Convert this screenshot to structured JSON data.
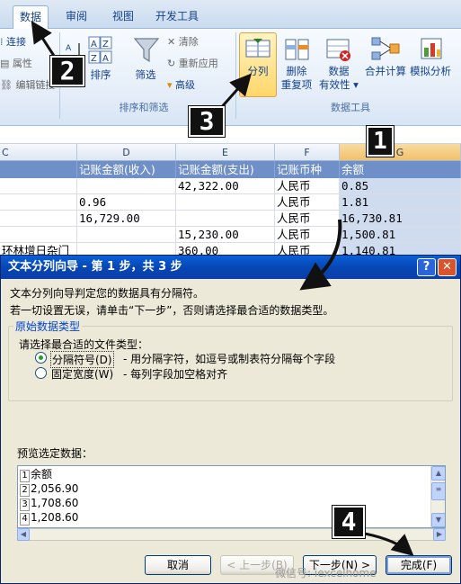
{
  "ribbon": {
    "tabs": [
      "数据",
      "审阅",
      "视图",
      "开发工具"
    ],
    "connections": {
      "items": [
        "连接",
        "属性",
        "编辑链接"
      ]
    },
    "sort": {
      "label": "排序"
    },
    "filter": {
      "label": "筛选",
      "items": [
        "清除",
        "重新应用",
        "高级"
      ]
    },
    "group_sort_filter": "排序和筛选",
    "split": {
      "label": "分列"
    },
    "dedupe": {
      "label_1": "删除",
      "label_2": "重复项"
    },
    "validate": {
      "label_1": "数据",
      "label_2": "有效性"
    },
    "consolidate": {
      "label": "合并计算"
    },
    "whatif": {
      "label": "模拟分析"
    },
    "group_data_tools": "数据工具"
  },
  "sheet": {
    "columns": [
      "C",
      "D",
      "E",
      "F",
      "G"
    ],
    "headers": [
      "记账金额(收入)",
      "记账金额(支出)",
      "记账币种",
      "余额"
    ],
    "rows": [
      {
        "c": "",
        "d": "",
        "e": "42,322.00",
        "f": "人民币",
        "g": "0.85"
      },
      {
        "c": "",
        "d": "0.96",
        "e": "",
        "f": "人民币",
        "g": "1.81"
      },
      {
        "c": "",
        "d": "16,729.00",
        "e": "",
        "f": "人民币",
        "g": "16,730.81"
      },
      {
        "c": "",
        "d": "",
        "e": "15,230.00",
        "f": "人民币",
        "g": "1,500.81"
      },
      {
        "c": "环林增日杂门",
        "d": "",
        "e": "360.00",
        "f": "人民币",
        "g": "1,140.81"
      }
    ]
  },
  "dialog": {
    "title": "文本分列向导 - 第 1 步，共 3 步",
    "help_btn": "?",
    "close_btn": "✕",
    "line1": "文本分列向导判定您的数据具有分隔符。",
    "line2": "若一切设置无误，请单击“下一步”，否则请选择最合适的数据类型。",
    "group_title": "原始数据类型",
    "group_prompt": "请选择最合适的文件类型：",
    "options": [
      {
        "label": "分隔符号(D)",
        "desc": "- 用分隔字符，如逗号或制表符分隔每个字段",
        "selected": true
      },
      {
        "label": "固定宽度(W)",
        "desc": "- 每列字段加空格对齐",
        "selected": false
      }
    ],
    "preview_label": "预览选定数据：",
    "preview_rows": [
      {
        "num": "1",
        "text": "余额"
      },
      {
        "num": "2",
        "text": "2,056.90"
      },
      {
        "num": "3",
        "text": "1,708.60"
      },
      {
        "num": "4",
        "text": "1,208.60"
      }
    ],
    "buttons": {
      "cancel": "取消",
      "back": "< 上一步(B)",
      "next": "下一步(N) >",
      "finish": "完成(F)"
    }
  },
  "callouts": [
    "1",
    "2",
    "3",
    "4"
  ],
  "watermark": "微信号: iexcelhome",
  "colors": {
    "ribbon_text": "#15428b",
    "header_fill": "#6f8fc8",
    "titlebar": "#0747b6"
  }
}
